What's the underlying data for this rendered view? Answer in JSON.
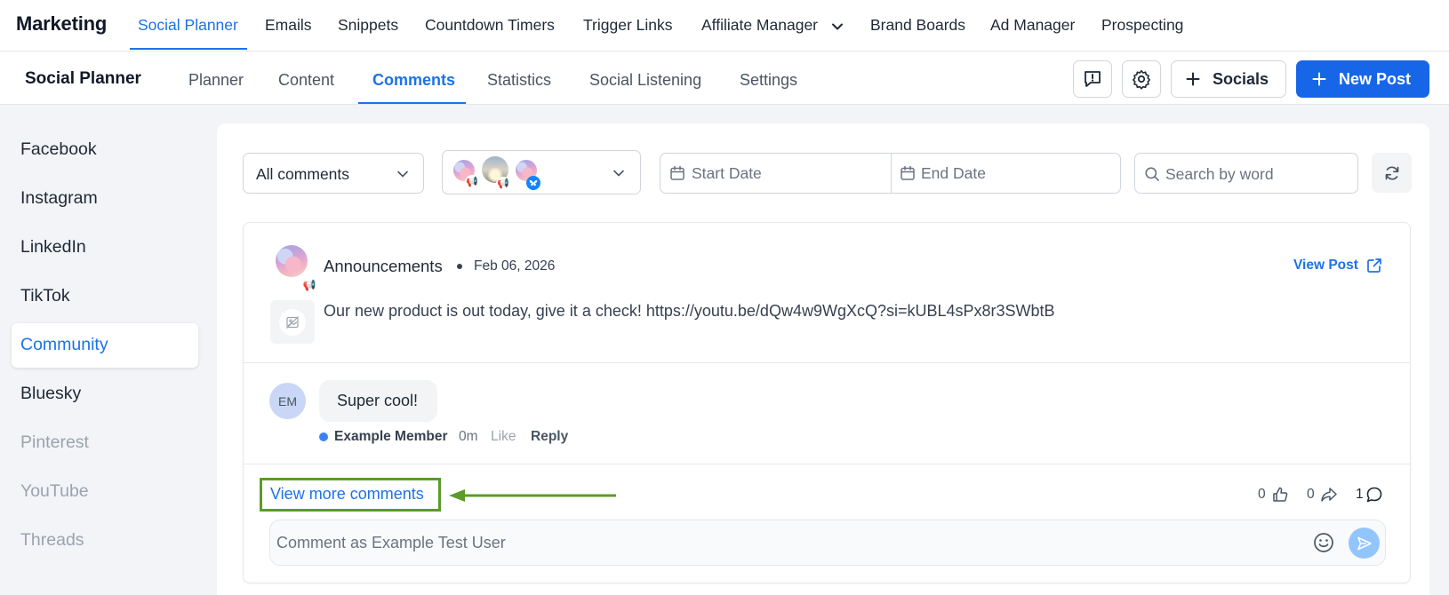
{
  "app": {
    "title": "Marketing"
  },
  "top_nav": {
    "items": [
      {
        "label": "Social Planner",
        "active": true
      },
      {
        "label": "Emails"
      },
      {
        "label": "Snippets"
      },
      {
        "label": "Countdown Timers"
      },
      {
        "label": "Trigger Links"
      },
      {
        "label": "Affiliate Manager",
        "has_dropdown": true
      },
      {
        "label": "Brand Boards"
      },
      {
        "label": "Ad Manager"
      },
      {
        "label": "Prospecting"
      }
    ]
  },
  "sub_nav": {
    "title": "Social Planner",
    "tabs": [
      {
        "label": "Planner"
      },
      {
        "label": "Content"
      },
      {
        "label": "Comments",
        "active": true
      },
      {
        "label": "Statistics"
      },
      {
        "label": "Social Listening"
      },
      {
        "label": "Settings"
      }
    ],
    "socials_label": "Socials",
    "new_post_label": "New Post"
  },
  "sidebar": {
    "items": [
      {
        "label": "Facebook",
        "state": "normal"
      },
      {
        "label": "Instagram",
        "state": "normal"
      },
      {
        "label": "LinkedIn",
        "state": "normal"
      },
      {
        "label": "TikTok",
        "state": "normal"
      },
      {
        "label": "Community",
        "state": "active"
      },
      {
        "label": "Bluesky",
        "state": "normal"
      },
      {
        "label": "Pinterest",
        "state": "disabled"
      },
      {
        "label": "YouTube",
        "state": "disabled"
      },
      {
        "label": "Threads",
        "state": "disabled"
      }
    ]
  },
  "filters": {
    "comment_filter": "All comments",
    "start_date_placeholder": "Start Date",
    "end_date_placeholder": "End Date",
    "search_placeholder": "Search by word"
  },
  "post": {
    "author": "Announcements",
    "date": "Feb 06, 2026",
    "view_post_label": "View Post",
    "text": "Our new product is out today, give it a check! https://youtu.be/dQw4w9WgXcQ?si=kUBL4sPx8r3SWbtB"
  },
  "comment": {
    "avatar_initials": "EM",
    "text": "Super cool!",
    "author": "Example Member",
    "time": "0m",
    "like_label": "Like",
    "reply_label": "Reply"
  },
  "footer": {
    "view_more_label": "View more comments",
    "likes_count": "0",
    "shares_count": "0",
    "comments_count": "1",
    "input_placeholder": "Comment as Example Test User"
  },
  "colors": {
    "accent": "#1d72e8",
    "primary_button": "#1866e8",
    "annotation_green": "#5a9b2a",
    "status_dot": "#3b82f6"
  }
}
